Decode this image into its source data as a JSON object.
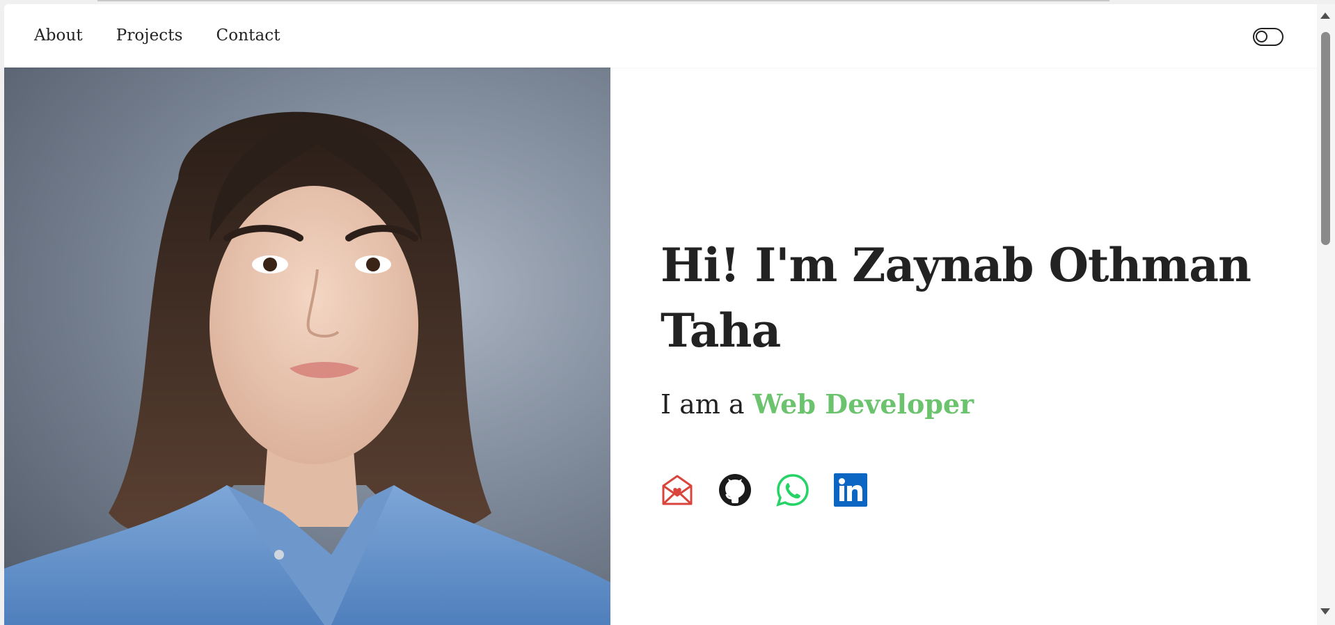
{
  "nav": {
    "items": [
      {
        "label": "About"
      },
      {
        "label": "Projects"
      },
      {
        "label": "Contact"
      }
    ],
    "theme_toggle_icon": "toggle-icon"
  },
  "hero": {
    "greeting": "Hi! I'm Zaynab Othman Taha",
    "subtitle_prefix": "I am a ",
    "role": "Web Developer",
    "role_color": "#6cc36e"
  },
  "photo": {
    "alt": "Portrait photo"
  },
  "socials": [
    {
      "icon": "email-heart-icon",
      "color": "#d9453d"
    },
    {
      "icon": "github-icon",
      "color": "#1b1b1b"
    },
    {
      "icon": "whatsapp-icon",
      "color": "#25d366"
    },
    {
      "icon": "linkedin-icon",
      "color": "#0a66c2"
    }
  ]
}
